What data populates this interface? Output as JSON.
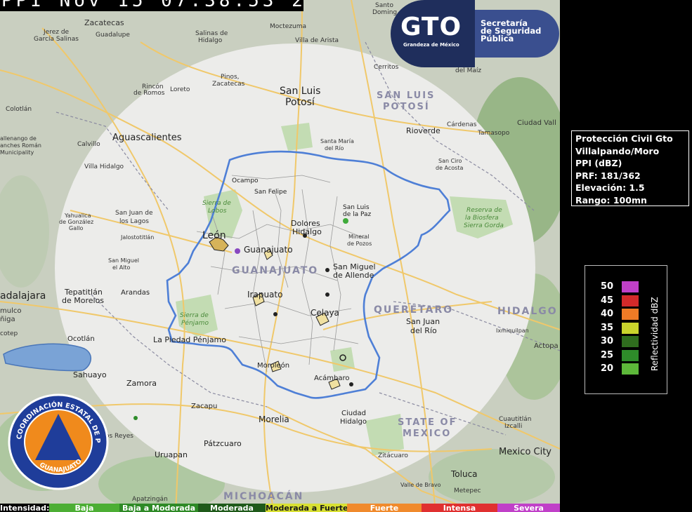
{
  "header": {
    "timestamp": "PPI  Nov 15 07:38:53  2019"
  },
  "logo": {
    "acronym": "GTO",
    "tagline": "Grandeza de México",
    "org_line1": "Secretaría",
    "org_line2": "de Seguridad",
    "org_line3": "Pública"
  },
  "seal": {
    "ring_text": "COORDINACIÓN ESTATAL DE PROTECCIÓN CIVIL",
    "bottom_text": "GUANAJUATO"
  },
  "radar_info": {
    "line1": "Protección Civil Gto",
    "line2": "Villalpando/Moro",
    "line3": "PPI (dBZ)",
    "line4": "PRF: 181/362",
    "line5": "Elevación: 1.5",
    "line6": "Rango: 100mn"
  },
  "legend": {
    "title": "Reflectividad   dBZ",
    "items": [
      {
        "value": "50",
        "color": "#c040c8"
      },
      {
        "value": "45",
        "color": "#d42a2a"
      },
      {
        "value": "40",
        "color": "#ef7b26"
      },
      {
        "value": "35",
        "color": "#c9d42c"
      },
      {
        "value": "30",
        "color": "#2f6e1e"
      },
      {
        "value": "25",
        "color": "#2e8c2a"
      },
      {
        "value": "20",
        "color": "#5db83a"
      }
    ]
  },
  "intensity_bar": {
    "label": "Intensidad:",
    "levels": [
      {
        "name": "Baja",
        "color": "#4cae34",
        "text_color": "#ffffff"
      },
      {
        "name": "Baja a Moderada",
        "color": "#2e8a26",
        "text_color": "#ffffff"
      },
      {
        "name": "Moderada",
        "color": "#1f5a1a",
        "text_color": "#ffffff"
      },
      {
        "name": "Moderada a Fuerte",
        "color": "#d8e032",
        "text_color": "#1a1a1a"
      },
      {
        "name": "Fuerte",
        "color": "#f08a2c",
        "text_color": "#ffffff"
      },
      {
        "name": "Intensa",
        "color": "#e03030",
        "text_color": "#ffffff"
      },
      {
        "name": "Severa",
        "color": "#c040c8",
        "text_color": "#ffffff"
      }
    ]
  },
  "map_labels": {
    "state_guanajuato": "GUANAJUATO",
    "state_sanluis1": "SAN LUIS",
    "state_sanluis2": "POTOSÍ",
    "state_queretaro": "QUERÉTARO",
    "state_hidalgo": "HIDALGO",
    "state_mexico1": "STATE OF",
    "state_mexico2": "MEXICO",
    "state_michoacan": "MICHOACÁN",
    "city_sanluis1": "San Luis",
    "city_sanluis2": "Potosí",
    "city_aguascalientes": "Aguascalientes",
    "city_leon": "León",
    "city_guanajuato": "Guanajuato",
    "city_irapuato": "Irapuato",
    "city_celaya": "Celaya",
    "city_queretaro1": "San Juan",
    "city_queretaro2": "del Río",
    "city_morelia": "Morelia",
    "city_guadalajara": "adalajara",
    "city_zacatecas": "Zacatecas",
    "city_mexico_city": "Mexico City",
    "city_toluca": "Toluca",
    "city_dolores1": "Dolores",
    "city_dolores2": "Hidalgo",
    "city_sma1": "San Miguel",
    "city_sma2": "de Allende",
    "city_penjamo": "La Piedad Pénjamo",
    "city_tepatitlan1": "Tepatitlán",
    "city_tepatitlan2": "de Morelos",
    "city_zamora": "Zamora",
    "city_uruapan": "Uruapan",
    "city_patzcuaro": "Pátzcuaro",
    "city_acambaro": "Acámbaro",
    "city_moroleon": "Moroleón",
    "city_rioverde": "Rioverde",
    "city_sanfelipe": "San Felipe",
    "city_ocampo": "Ocampo",
    "city_arandas": "Arandas",
    "city_ciudadhidalgo1": "Ciudad",
    "city_ciudadhidalgo2": "Hidalgo",
    "city_zacapu": "Zacapu",
    "city_sahuayo": "Sahuayo",
    "city_ocotlan": "Ocotlán",
    "city_jerez1": "Jerez de",
    "city_jerez2": "García Salinas",
    "city_guadalupe": "Guadalupe",
    "city_salinas1": "Salinas de",
    "city_salinas2": "Hidalgo",
    "city_moctezuma": "Moctezuma",
    "city_villadearista": "Villa de Arista",
    "city_cerritos": "Cerritos",
    "city_rincon1": "Rincón",
    "city_rincon2": "de Romos",
    "city_loreto": "Loreto",
    "city_pinos1": "Pinos,",
    "city_pinos2": "Zacatecas",
    "city_santamaria1": "Santa María",
    "city_santamaria2": "del Río",
    "city_villahidalgo": "Villa Hidalgo",
    "city_calvillo": "Calvillo",
    "city_sanjuanlagos1": "San Juan de",
    "city_sanjuanlagos2": "los Lagos",
    "city_jalostotitlan": "Jalostotitlán",
    "city_sanmiguelalto1": "San Miguel",
    "city_sanmiguelalto2": "el Alto",
    "city_yahualica1": "Yahualica",
    "city_yahualica2": "de González",
    "city_yahualica3": "Gallo",
    "city_sierralobos1": "Sierra de",
    "city_sierralobos2": "Lobos",
    "city_sierrapenjamo1": "Sierra de",
    "city_sierrapenjamo2": "Pénjamo",
    "city_sanluisdelapaz1": "San Luis",
    "city_sanluisdelapaz2": "de la Paz",
    "city_mineral1": "Mineral",
    "city_mineral2": "de Pozos",
    "city_biosfera1": "Reserva de",
    "city_biosfera2": "la Biosfera",
    "city_biosfera3": "Sierra Gorda",
    "city_cardenas": "Cárdenas",
    "city_tamasopo": "Tamasopo",
    "city_ciudadvalles": "Ciudad Vall",
    "city_sanciro1": "San Ciro",
    "city_sanciro2": "de Acosta",
    "city_ixmiquilpan": "Ixmiquilpan",
    "city_actopan": "Actopa",
    "city_zitacuaro": "Zitácuaro",
    "city_cuautitlan1": "Cuautitlán",
    "city_cuautitlan2": "Izcalli",
    "city_metepec": "Metepec",
    "city_valledebravo": "Valle de Bravo",
    "city_apatzingan": "Apatzingán",
    "city_losreyes": "os Reyes",
    "city_colotlan": "Colotlán",
    "city_santodomingo1": "Santo",
    "city_santodomingo2": "Doming",
    "city_delmaiz": "del Maíz",
    "city_valparaiso1": "allenango de",
    "city_valparaiso2": "anches Román",
    "city_valparaiso3": "Municipality",
    "city_mulco1": "mulco",
    "city_mulco2": "ñiga",
    "city_jocotepec": "cotep"
  }
}
